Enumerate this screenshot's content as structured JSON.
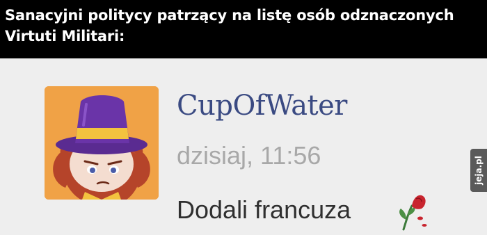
{
  "caption": "Sanacyjni politycy patrzący na listę osób odznaczonych Virtuti Militari:",
  "comment": {
    "username": "CupOfWater",
    "timestamp": "dzisiaj, 11:56",
    "message": "Dodali francuza",
    "emoji_icon": "wilted-flower-icon"
  },
  "watermark": "jeja.pl",
  "colors": {
    "caption_background": "#000000",
    "caption_text": "#ffffff",
    "panel_background": "#eeeeee",
    "username": "#3a4a82",
    "timestamp": "#a8a8a8",
    "message": "#2f2f2f",
    "avatar_background": "#f0a246",
    "hat_purple": "#6a34a8",
    "hat_band": "#f3c33f"
  }
}
